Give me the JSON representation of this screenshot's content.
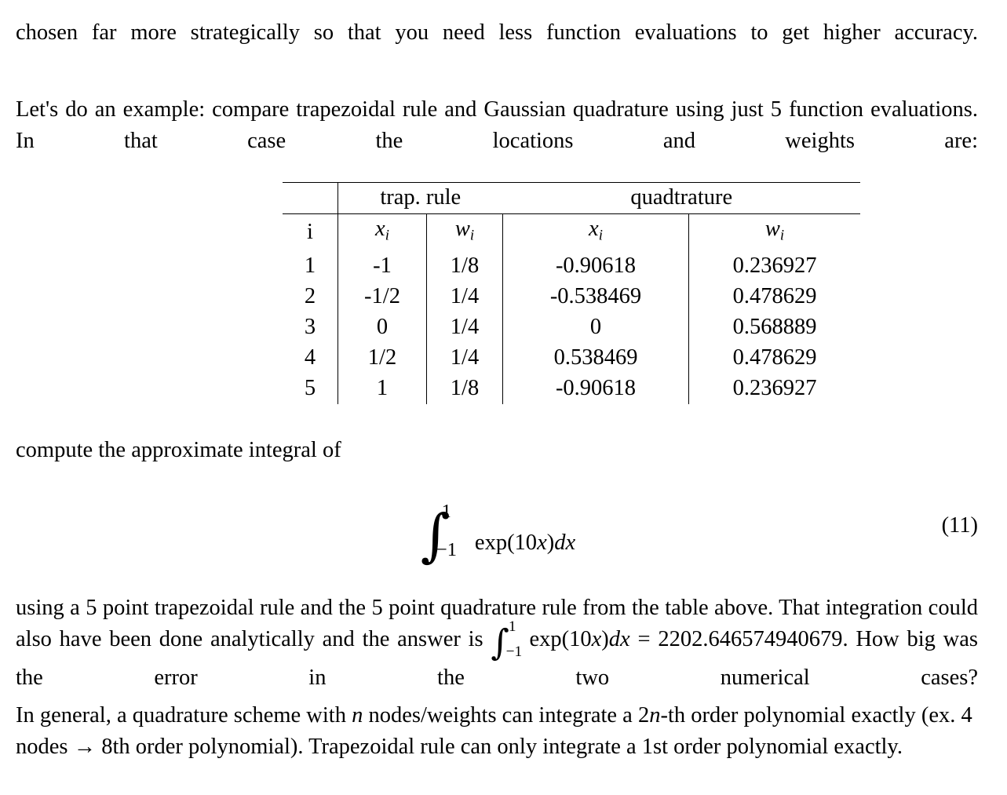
{
  "document": {
    "paragraph_1": "chosen far more strategically so that you need less function evaluations to get higher accuracy.",
    "paragraph_2": "Let's do an example: compare trapezoidal rule and Gaussian quadrature using just 5 function evaluations. In that case the locations and weights are:",
    "lead_in": "compute the approximate integral of",
    "equation_number": "(11)"
  },
  "table": {
    "group_headers": {
      "blank": "",
      "trapezoidal": "trap. rule",
      "quadrature": "quadtrature"
    },
    "column_headers": {
      "index": "i",
      "trap_x": "x",
      "trap_x_sub": "i",
      "trap_w": "w",
      "trap_w_sub": "i",
      "quad_x": "x",
      "quad_x_sub": "i",
      "quad_w": "w",
      "quad_w_sub": "i"
    },
    "rows": [
      {
        "i": "1",
        "trap_x": "-1",
        "trap_w": "1/8",
        "quad_x": "-0.90618",
        "quad_w": "0.236927"
      },
      {
        "i": "2",
        "trap_x": "-1/2",
        "trap_w": "1/4",
        "quad_x": "-0.538469",
        "quad_w": "0.478629"
      },
      {
        "i": "3",
        "trap_x": "0",
        "trap_w": "1/4",
        "quad_x": "0",
        "quad_w": "0.568889"
      },
      {
        "i": "4",
        "trap_x": "1/2",
        "trap_w": "1/4",
        "quad_x": "0.538469",
        "quad_w": "0.478629"
      },
      {
        "i": "5",
        "trap_x": "1",
        "trap_w": "1/8",
        "quad_x": "-0.90618",
        "quad_w": "0.236927"
      }
    ]
  },
  "equation": {
    "integral_symbol": "∫",
    "lower_limit": "−1",
    "upper_limit": "1",
    "integrand_prefix": "exp(10",
    "integrand_var": "x",
    "integrand_suffix": ")",
    "differential_d": "d",
    "differential_var": "x"
  },
  "paragraph_3": {
    "part_1": "using a 5 point trapezoidal rule and the 5 point quadrature rule from the table above. That integration could also have been done analytically and the answer is ",
    "inline_integral": {
      "symbol": "∫",
      "lower": "−1",
      "upper": "1",
      "prefix": "exp(10",
      "var": "x",
      "suffix": ")",
      "d": "d",
      "dvar": "x",
      "equals": "="
    },
    "part_2": "2202.646574940679. How big was the error in the two numerical cases?"
  },
  "paragraph_4": {
    "part_1": "In general, a quadrature scheme with ",
    "var_n": "n",
    "part_2": " nodes/weights can integrate a 2",
    "var_n2": "n",
    "part_3": "-th order polynomial exactly (ex. 4 nodes ",
    "arrow": "→",
    "part_4": " 8th order polynomial). Trapezoidal rule can only integrate a 1st order polynomial exactly."
  }
}
